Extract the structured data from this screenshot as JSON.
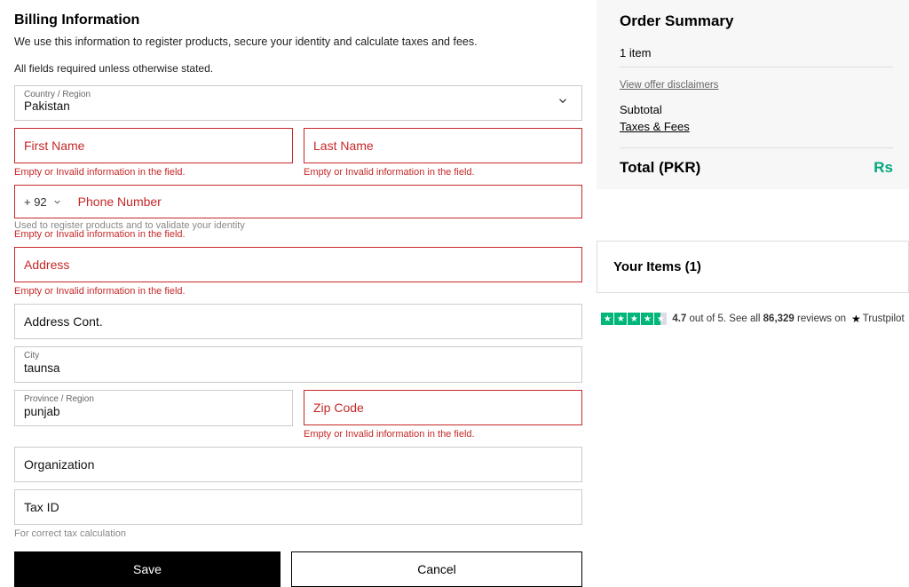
{
  "billing": {
    "title": "Billing Information",
    "subtitle": "We use this information to register products, secure your identity and calculate taxes and fees.",
    "required_note": "All fields required unless otherwise stated.",
    "country_label": "Country / Region",
    "country_value": "Pakistan",
    "first_name_label": "First Name",
    "last_name_label": "Last Name",
    "error_empty": "Empty or Invalid information in the field.",
    "phone_cc": "+ 92",
    "phone_label": "Phone Number",
    "phone_hint": "Used to register products and to validate your identity",
    "address_label": "Address",
    "address_cont_label": "Address Cont.",
    "city_label": "City",
    "city_value": "taunsa",
    "province_label": "Province / Region",
    "province_value": "punjab",
    "zip_label": "Zip Code",
    "org_label": "Organization",
    "taxid_label": "Tax ID",
    "taxid_hint": "For correct tax calculation",
    "save_label": "Save",
    "cancel_label": "Cancel"
  },
  "summary": {
    "title": "Order Summary",
    "item_count": "1 item",
    "disclaimers": "View offer disclaimers",
    "subtotal": "Subtotal",
    "taxes": "Taxes & Fees",
    "total_label": "Total (PKR)",
    "total_amount": "Rs",
    "your_items": "Your Items (1)"
  },
  "trust": {
    "rating": "4.7",
    "out_of": " out of 5. See all ",
    "reviews": "86,329",
    "reviews_on": " reviews on ",
    "brand": "Trustpilot"
  }
}
